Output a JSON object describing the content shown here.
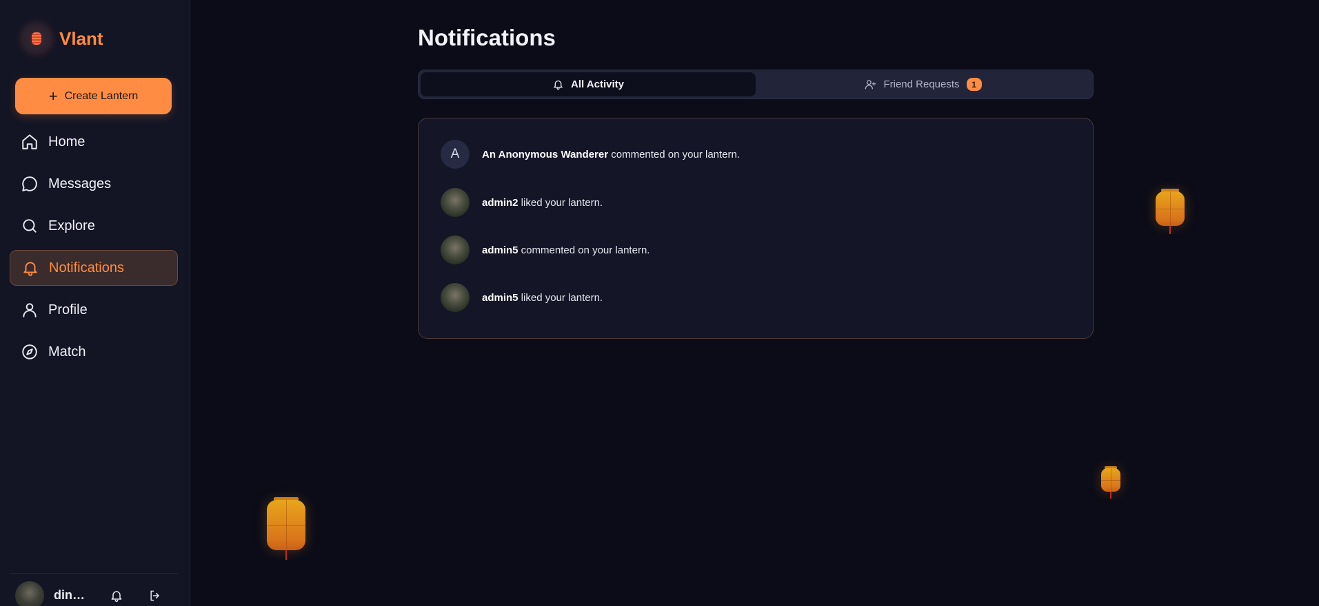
{
  "sidebar": {
    "brand_name": "Vlant",
    "create_button_label": "Create Lantern",
    "items": [
      {
        "label": "Home",
        "icon": "home-icon"
      },
      {
        "label": "Messages",
        "icon": "message-icon"
      },
      {
        "label": "Explore",
        "icon": "search-icon"
      },
      {
        "label": "Notifications",
        "icon": "bell-icon",
        "active": true
      },
      {
        "label": "Profile",
        "icon": "user-icon"
      },
      {
        "label": "Match",
        "icon": "compass-icon"
      }
    ],
    "footer": {
      "username": "dinh..."
    }
  },
  "main": {
    "title": "Notifications",
    "tabs": [
      {
        "label": "All Activity",
        "icon": "bell-icon",
        "active": true
      },
      {
        "label": "Friend Requests",
        "icon": "user-plus-icon",
        "badge": "1"
      }
    ],
    "notifications": [
      {
        "avatar_letter": "A",
        "actor": "An Anonymous Wanderer",
        "action": " commented on your lantern."
      },
      {
        "actor": "admin2",
        "action": " liked your lantern."
      },
      {
        "actor": "admin5",
        "action": " commented on your lantern."
      },
      {
        "actor": "admin5",
        "action": " liked your lantern."
      }
    ]
  },
  "colors": {
    "accent": "#ff8c42",
    "background": "#0b0c18",
    "sidebar": "#131525"
  }
}
